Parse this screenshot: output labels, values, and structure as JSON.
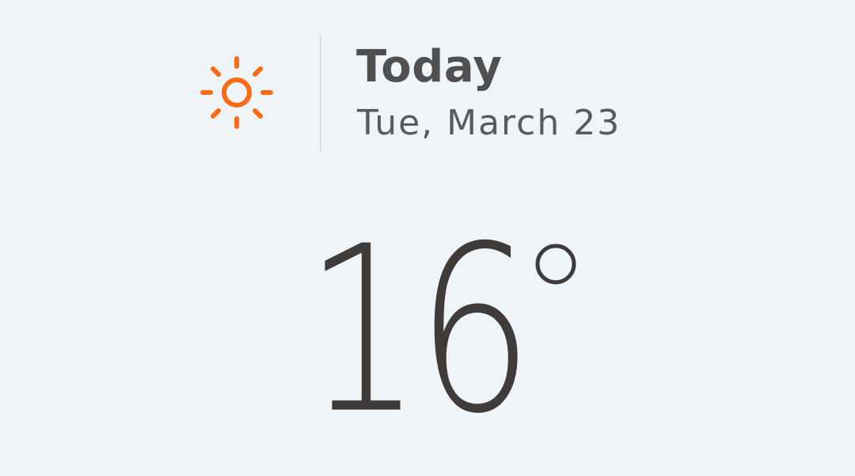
{
  "header": {
    "icon": "sun-icon",
    "accent_color": "#ff6a13",
    "title": "Today",
    "date": "Tue, March 23"
  },
  "temperature": {
    "value": "16",
    "unit_icon": "degree-icon"
  }
}
